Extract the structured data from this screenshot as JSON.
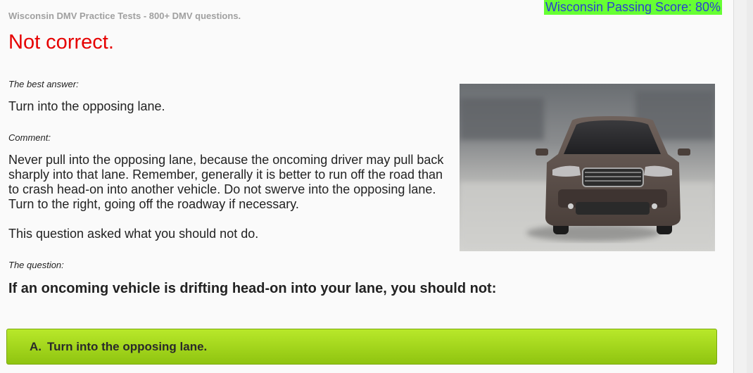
{
  "header": {
    "site_title": "Wisconsin DMV Practice Tests - 800+ DMV questions.",
    "passing_score": "Wisconsin Passing Score: 80%"
  },
  "result": {
    "status": "Not correct.",
    "best_answer_label": "The best answer:",
    "best_answer": "Turn into the opposing lane.",
    "comment_label": "Comment:",
    "comment_paragraphs": [
      "Never pull into the opposing lane, because the oncoming driver may pull back sharply into that lane. Remember, generally it is better to run off the road than to crash head-on into another vehicle. Do not swerve into the opposing lane. Turn to the right, going off the roadway if necessary.",
      "This question asked what you should not do."
    ]
  },
  "question": {
    "label": "The question:",
    "text": "If an oncoming vehicle is drifting head-on into your lane, you should not:"
  },
  "answers": [
    {
      "letter": "A.",
      "text": "Turn into the opposing lane."
    }
  ],
  "colors": {
    "result_red": "#e60000",
    "score_bg": "#66ff33",
    "score_text": "#2a3fd1",
    "answer_green": "#a4d41c"
  },
  "illustration": "car-driving-head-on-photo"
}
